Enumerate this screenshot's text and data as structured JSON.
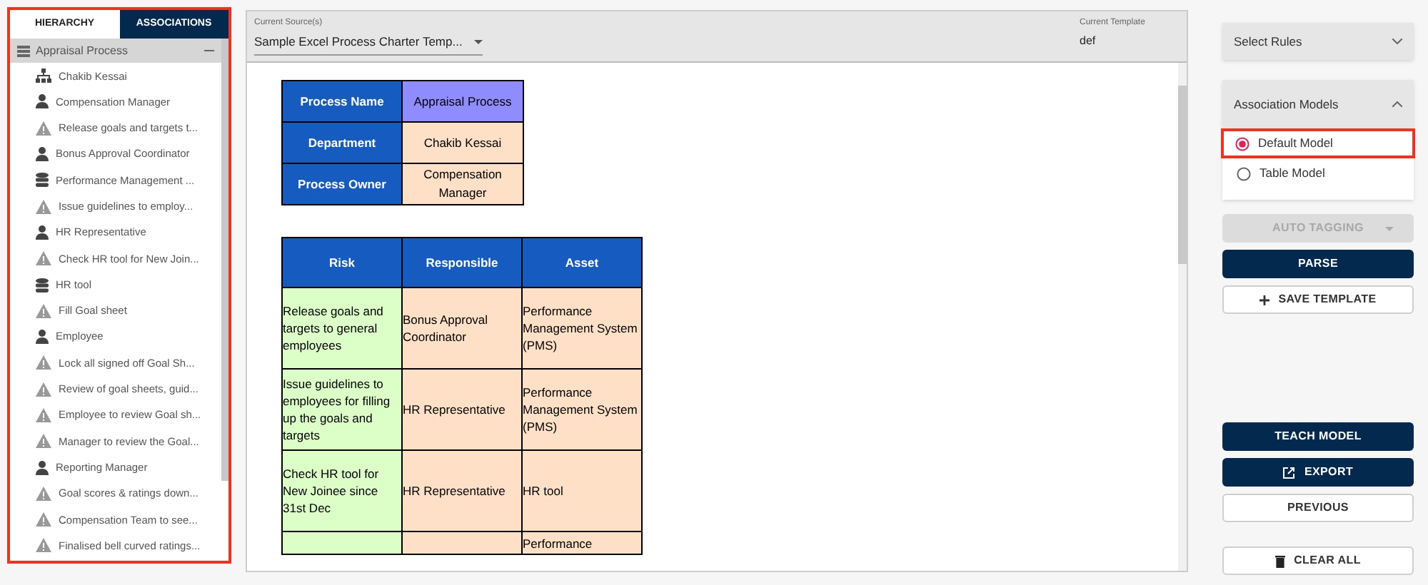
{
  "sidebar": {
    "highlighted": true,
    "tabs": [
      {
        "label": "HIERARCHY",
        "selected": true
      },
      {
        "label": "ASSOCIATIONS",
        "selected": false
      }
    ],
    "root": {
      "label": "Appraisal Process",
      "expanded": true,
      "children": [
        {
          "kind": "org",
          "label": "Chakib Kessai"
        },
        {
          "kind": "person",
          "label": "Compensation Manager"
        },
        {
          "kind": "risk",
          "label": "Release goals and targets t..."
        },
        {
          "kind": "person",
          "label": "Bonus Approval Coordinator"
        },
        {
          "kind": "asset",
          "label": "Performance Management ..."
        },
        {
          "kind": "risk",
          "label": "Issue guidelines to employ..."
        },
        {
          "kind": "person",
          "label": "HR Representative"
        },
        {
          "kind": "risk",
          "label": "Check HR tool for New Join..."
        },
        {
          "kind": "asset",
          "label": "HR tool"
        },
        {
          "kind": "risk",
          "label": "Fill Goal sheet"
        },
        {
          "kind": "person",
          "label": "Employee"
        },
        {
          "kind": "risk",
          "label": "Lock all signed off Goal Sh..."
        },
        {
          "kind": "risk",
          "label": "Review of goal sheets, guid..."
        },
        {
          "kind": "risk",
          "label": "Employee to review Goal sh..."
        },
        {
          "kind": "risk",
          "label": "Manager to review the Goal..."
        },
        {
          "kind": "person",
          "label": "Reporting Manager"
        },
        {
          "kind": "risk",
          "label": "Goal scores & ratings down..."
        },
        {
          "kind": "risk",
          "label": "Compensation Team to see..."
        },
        {
          "kind": "risk",
          "label": "Finalised bell curved ratings..."
        }
      ]
    }
  },
  "source": {
    "label": "Current Source(s)",
    "value": "Sample Excel Process Charter Temp..."
  },
  "template": {
    "label": "Current Template",
    "value": "def"
  },
  "charter": [
    {
      "label": "Process Name",
      "value": "Appraisal Process",
      "color": "#8f8cff"
    },
    {
      "label": "Department",
      "value": "Chakib Kessai",
      "color": "#fde0c5"
    },
    {
      "label": "Process Owner",
      "value": "Compensation Manager",
      "color": "#fde0c5"
    }
  ],
  "table": {
    "columns": [
      "Risk",
      "Responsible",
      "Asset"
    ],
    "rows": [
      [
        "Release goals and targets to general employees",
        "Bonus Approval Coordinator",
        "Performance Management System (PMS)"
      ],
      [
        "Issue guidelines to employees for filling up the goals and targets",
        "HR Representative",
        "Performance Management System (PMS)"
      ],
      [
        "Check HR tool for New Joinee since 31st Dec",
        "HR Representative",
        "HR tool"
      ],
      [
        "",
        "",
        "Performance"
      ]
    ]
  },
  "rules": {
    "label": "Select Rules",
    "expanded": false
  },
  "models": {
    "label": "Association Models",
    "expanded": true,
    "options": [
      {
        "label": "Default Model",
        "selected": true,
        "highlighted": true
      },
      {
        "label": "Table Model",
        "selected": false,
        "highlighted": false
      }
    ]
  },
  "button_groups": [
    [
      {
        "label": "AUTO TAGGING",
        "kind": "dropdown",
        "disabled": true
      },
      {
        "label": "PARSE",
        "kind": "primary"
      },
      {
        "label": "SAVE TEMPLATE",
        "kind": "add"
      }
    ],
    [
      {
        "label": "TEACH MODEL",
        "kind": "primary"
      },
      {
        "label": "EXPORT",
        "kind": "export"
      },
      {
        "label": "PREVIOUS",
        "kind": "outline"
      }
    ],
    [
      {
        "label": "CLEAR ALL",
        "kind": "clear"
      }
    ]
  ]
}
